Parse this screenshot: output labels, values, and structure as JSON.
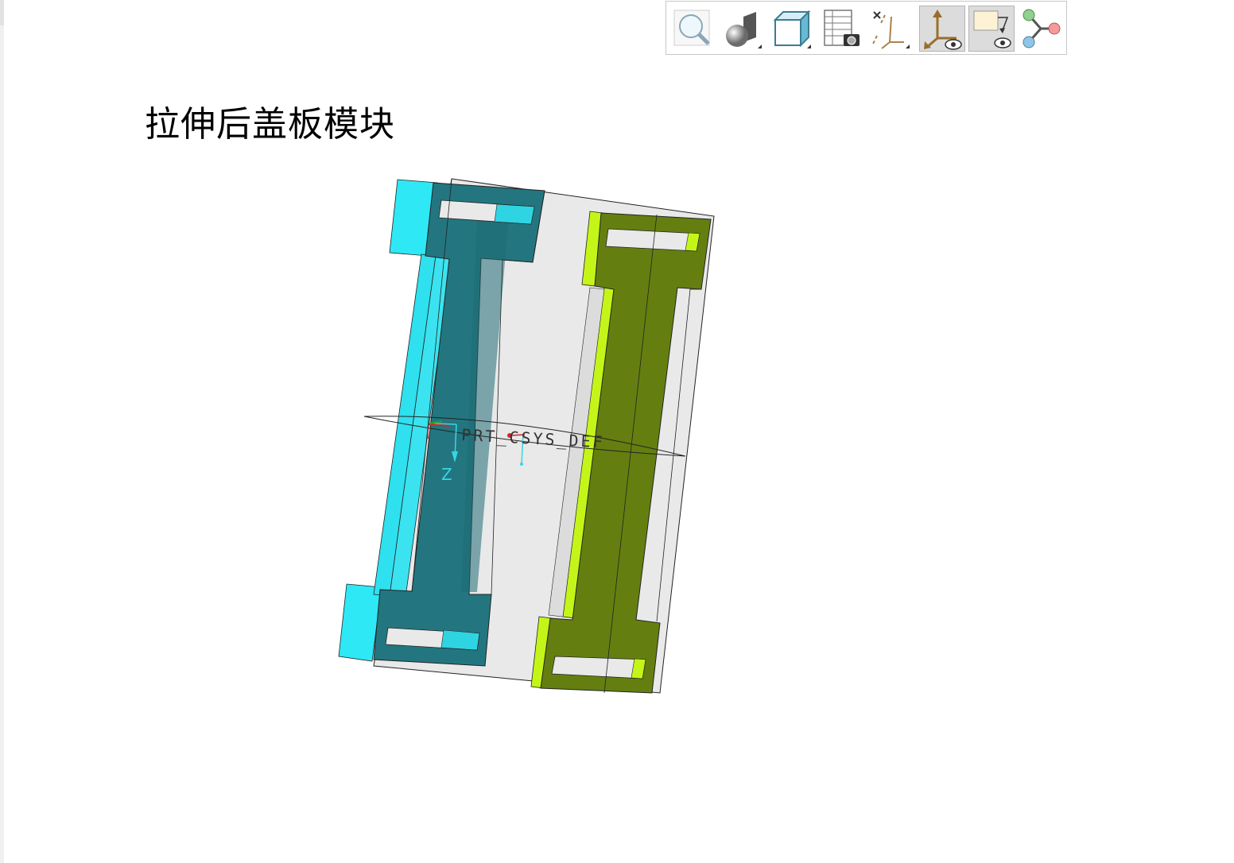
{
  "page": {
    "title": "拉伸后盖板模块"
  },
  "toolbar": {
    "buttons": [
      {
        "icon": "zoom-icon",
        "pressed": false
      },
      {
        "icon": "display-style-icon",
        "pressed": false
      },
      {
        "icon": "saved-views-icon",
        "pressed": false
      },
      {
        "icon": "view-manager-icon",
        "pressed": false
      },
      {
        "icon": "datum-display-icon",
        "pressed": false
      },
      {
        "icon": "csys-display-icon",
        "pressed": true
      },
      {
        "icon": "annotation-display-icon",
        "pressed": true
      },
      {
        "icon": "spin-center-icon",
        "pressed": false
      }
    ]
  },
  "model": {
    "csys_label": "PRT_CSYS_DEF",
    "axis_label": "Z",
    "colors": {
      "left_part_face": "#23767f",
      "left_part_edge": "#2ee8f6",
      "right_part_face": "#647f10",
      "right_part_edge": "#c4f519",
      "transparent_plate": "#e8e8e8",
      "csys_axis": "#36d6e6"
    }
  }
}
